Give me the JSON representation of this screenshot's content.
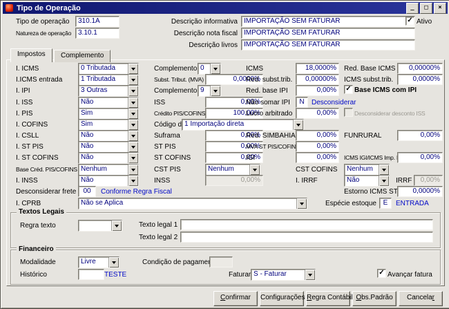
{
  "colors": {
    "titlebar": "#10176f",
    "value_text": "#00007d",
    "link_blue": "#0008c8",
    "window_bg": "#e6e4df"
  },
  "window": {
    "title": "Tipo de Operação",
    "minimize": "_",
    "maximize": "□",
    "close": "×"
  },
  "header": {
    "tipo": {
      "label": "Tipo de operação",
      "value": "310.1A"
    },
    "natureza": {
      "label": "Natureza de operação",
      "value": "3.10.1"
    },
    "desc_informativa": {
      "label": "Descrição informativa",
      "value": "IMPORTAÇÃO SEM FATURAR"
    },
    "desc_nota_fiscal": {
      "label": "Descrição nota fiscal",
      "value": "IMPORTAÇÃO SEM FATURAR"
    },
    "desc_livros": {
      "label": "Descrição livros",
      "value": "IMPORTAÇÃO SEM FATURAR"
    },
    "ativo": {
      "label": "Ativo",
      "checked": true
    }
  },
  "tabs": {
    "impostos": "Impostos",
    "complemento": "Complemento"
  },
  "impostos": {
    "icms_ind": {
      "label": "I. ICMS",
      "value": "0 Tributada"
    },
    "complemento_icms": {
      "label": "Complemento",
      "value": "0"
    },
    "icms_pct": {
      "label": "ICMS",
      "value": "18,0000%"
    },
    "red_base_icms": {
      "label": "Red. Base ICMS",
      "value": "0,00000%"
    },
    "icms_entrada": {
      "label": "I.ICMS entrada",
      "value": "1 Tributada"
    },
    "subst_trib_mva": {
      "label": "Subst. Tribut. (MVA)",
      "value": "0,0000%"
    },
    "red_subst_trib": {
      "label": "Red. subst.trib.",
      "value": "0,00000%"
    },
    "icms_subst_trib": {
      "label": "ICMS subst.trib.",
      "value": "0,0000%"
    },
    "ipi_ind": {
      "label": "I. IPI",
      "value": "3 Outras"
    },
    "complemento_ipi": {
      "label": "Complemento",
      "value": "9"
    },
    "red_base_ipi": {
      "label": "Red. base IPI",
      "value": "0,00%"
    },
    "base_icms_com_ipi": {
      "label": "Base ICMS com IPI",
      "checked": true
    },
    "iss_ind": {
      "label": "I. ISS",
      "value": "Não"
    },
    "iss_pct": {
      "label": "ISS",
      "value": "0,00%"
    },
    "nao_somar_ipi": {
      "label": "Não somar IPI",
      "value": "N",
      "link": "Desconsiderar"
    },
    "pis_ind": {
      "label": "I. PIS",
      "value": "Sim"
    },
    "credito_pis_cofins": {
      "label": "Crédito PIS/COFINS",
      "value": "100,00%"
    },
    "lucro_arbitrado": {
      "label": "Lucro arbitrado",
      "value": "0,00%"
    },
    "desconsiderar_desconto_iss": {
      "label": "Desconsiderar desconto ISS",
      "checked": false
    },
    "cofins_ind": {
      "label": "I. COFINS",
      "value": "Sim"
    },
    "codigo_origem": {
      "label": "Código de origem",
      "value": "1 Importação direta"
    },
    "csll_ind": {
      "label": "I. CSLL",
      "value": "Não"
    },
    "suframa": {
      "label": "Suframa",
      "value": "0,00%"
    },
    "red_simbahia": {
      "label": "Red. SIMBAHIA",
      "value": "0,00%"
    },
    "funrural": {
      "label": "FUNRURAL",
      "value": "0,00%"
    },
    "st_pis_ind": {
      "label": "I. ST PIS",
      "value": "Não"
    },
    "st_pis_pct": {
      "label": "ST PIS",
      "value": "0,00%"
    },
    "mva_st_pis_cofins": {
      "label": "MVA ST PIS/COFINS",
      "value": "0,00%"
    },
    "st_cofins_ind": {
      "label": "I. ST COFINS",
      "value": "Não"
    },
    "st_cofins_pct": {
      "label": "ST COFINS",
      "value": "0,00%"
    },
    "igi": {
      "label": "IGI",
      "value": "0,00%"
    },
    "icms_igi_imp_pr": {
      "label": "ICMS IGI/ICMS Imp. PR",
      "value": "0,00%"
    },
    "base_cred_pis_cofins": {
      "label": "Base Créd. PIS/COFINS",
      "value": "Nenhum"
    },
    "cst_pis": {
      "label": "CST PIS",
      "value": "Nenhum"
    },
    "cst_cofins": {
      "label": "CST COFINS",
      "value": "Nenhum"
    },
    "inss_ind": {
      "label": "I. INSS",
      "value": "Não"
    },
    "inss_pct": {
      "label": "INSS",
      "value": "0,00%"
    },
    "irrf_ind": {
      "label": "I. IRRF",
      "value": "Não"
    },
    "irrf_pct": {
      "label": "IRRF",
      "value": "0,00%"
    },
    "desconsiderar_frete": {
      "label": "Desconsiderar frete",
      "value": "00",
      "link": "Conforme Regra Fiscal"
    },
    "estorno_icms_st": {
      "label": "Estorno ICMS ST",
      "value": "0,0000%"
    },
    "cprb": {
      "label": "I. CPRB",
      "value": "Não se Aplica"
    },
    "especie_estoque": {
      "label": "Espécie estoque",
      "value": "E",
      "link": "ENTRADA"
    }
  },
  "textos_legais": {
    "title": "Textos Legais",
    "regra_texto": {
      "label": "Regra texto",
      "value": ""
    },
    "texto_legal_1": {
      "label": "Texto legal 1",
      "value": ""
    },
    "texto_legal_2": {
      "label": "Texto legal 2",
      "value": ""
    }
  },
  "financeiro": {
    "title": "Financeiro",
    "modalidade": {
      "label": "Modalidade",
      "value": "Livre"
    },
    "condicao_pagamento": {
      "label": "Condição de pagamento",
      "value": ""
    },
    "historico": {
      "label": "Histórico",
      "value": "",
      "link": "TESTE"
    },
    "faturar": {
      "label": "Faturar",
      "value": "S - Faturar"
    },
    "avancar_fatura": {
      "label": "Avançar fatura",
      "checked": true
    }
  },
  "footer": {
    "confirmar": "Confirmar",
    "configuracoes": "Configurações",
    "regra_contabil": "Regra Contábil",
    "obs_padrao": "Obs.Padrão",
    "cancelar": "Cancelar"
  }
}
